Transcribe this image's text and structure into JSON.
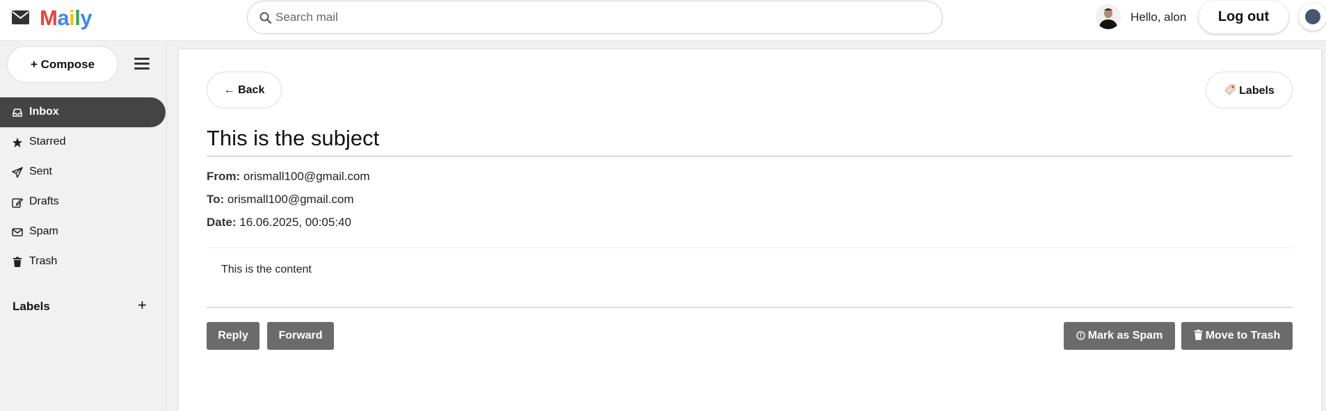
{
  "header": {
    "logo_letters": [
      "M",
      "a",
      "i",
      "l",
      "y"
    ],
    "logo_colors": [
      "#EA4335",
      "#4285F4",
      "#FBBC05",
      "#34A853",
      "#4285F4"
    ],
    "search_placeholder": "Search mail",
    "greeting": "Hello, alon",
    "logout_label": "Log out"
  },
  "sidebar": {
    "compose_label": "+ Compose",
    "items": [
      {
        "label": "Inbox",
        "icon": "inbox-icon",
        "active": true
      },
      {
        "label": "Starred",
        "icon": "star-icon"
      },
      {
        "label": "Sent",
        "icon": "send-icon"
      },
      {
        "label": "Drafts",
        "icon": "edit-icon"
      },
      {
        "label": "Spam",
        "icon": "envelope-icon"
      },
      {
        "label": "Trash",
        "icon": "trash-icon"
      }
    ],
    "labels_heading": "Labels",
    "labels_add": "+"
  },
  "email": {
    "back_label": "← Back",
    "labels_label": "Labels",
    "subject": "This is the subject",
    "from_key": "From:",
    "from_value": "orismall100@gmail.com",
    "to_key": "To:",
    "to_value": "orismall100@gmail.com",
    "date_key": "Date:",
    "date_value": "16.06.2025, 00:05:40",
    "body": "This is the content"
  },
  "actions": {
    "reply": "Reply",
    "forward": "Forward",
    "spam": "Mark as Spam",
    "trash": "Move to Trash"
  },
  "colors": {
    "active_nav": "#444444",
    "action_button": "#6b6b6b"
  }
}
